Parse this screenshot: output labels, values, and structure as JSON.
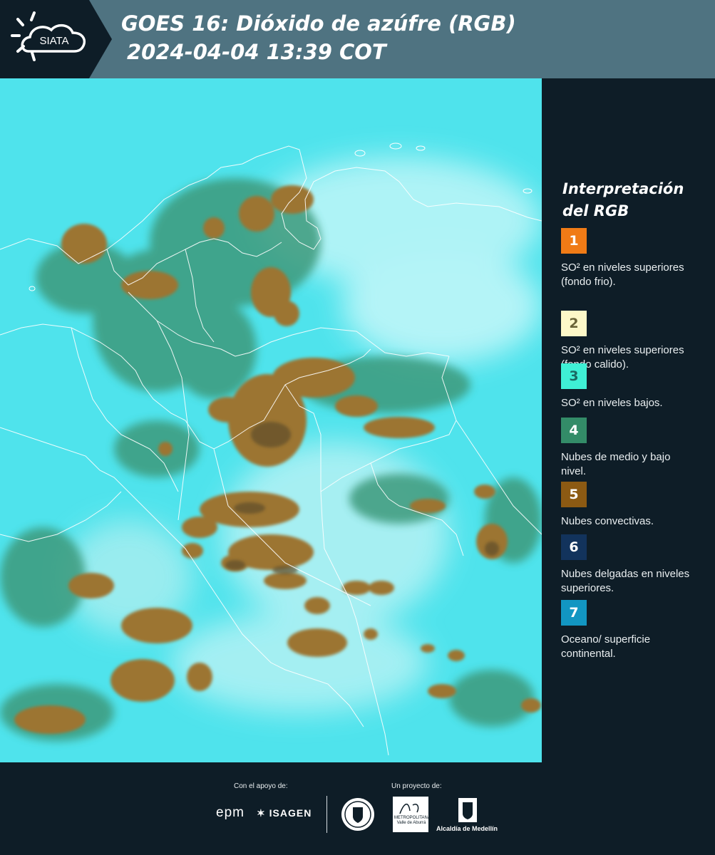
{
  "header": {
    "logo_text": "SIATA",
    "title_line1": "GOES 16: Dióxido de azúfre (RGB)",
    "title_line2": "2024-04-04 13:39 COT"
  },
  "colors": {
    "header_bg": "#4f7381",
    "page_bg": "#0e1d27",
    "map_ocean": "#4fe3ec",
    "map_land": "#3c9a7c",
    "convective": "#9c7530",
    "boundaries": "#ffffff"
  },
  "legend": {
    "title": "Interpretación del RGB",
    "items": [
      {
        "number": "1",
        "label": "SO² en niveles superiores (fondo frio).",
        "color": "#f07b16",
        "text_color": "#ffffff"
      },
      {
        "number": "2",
        "label": "SO² en niveles superiores (fondo calido).",
        "color": "#fdf8c8",
        "text_color": "#6a6438"
      },
      {
        "number": "3",
        "label": "SO² en niveles bajos.",
        "color": "#3ff0d5",
        "text_color": "#1b6a62"
      },
      {
        "number": "4",
        "label": "Nubes de medio y bajo nivel.",
        "color": "#338c68",
        "text_color": "#ffffff"
      },
      {
        "number": "5",
        "label": "Nubes convectivas.",
        "color": "#8c5a13",
        "text_color": "#ffffff"
      },
      {
        "number": "6",
        "label": "Nubes delgadas en niveles superiores.",
        "color": "#12335c",
        "text_color": "#ffffff"
      },
      {
        "number": "7",
        "label": "Oceano/ superficie continental.",
        "color": "#1296c2",
        "text_color": "#ffffff"
      }
    ]
  },
  "footer": {
    "support_label": "Con el apoyo de:",
    "project_label": "Un proyecto de:",
    "sponsors": [
      "epm",
      "ISAGEN"
    ],
    "partners": [
      "Área Metropolitana Valle de Aburrá",
      "Alcaldía de Medellín"
    ],
    "area_text": "METROPOLITANA Valle de Aburrá",
    "medellin_text": "Alcaldía de Medellín"
  }
}
